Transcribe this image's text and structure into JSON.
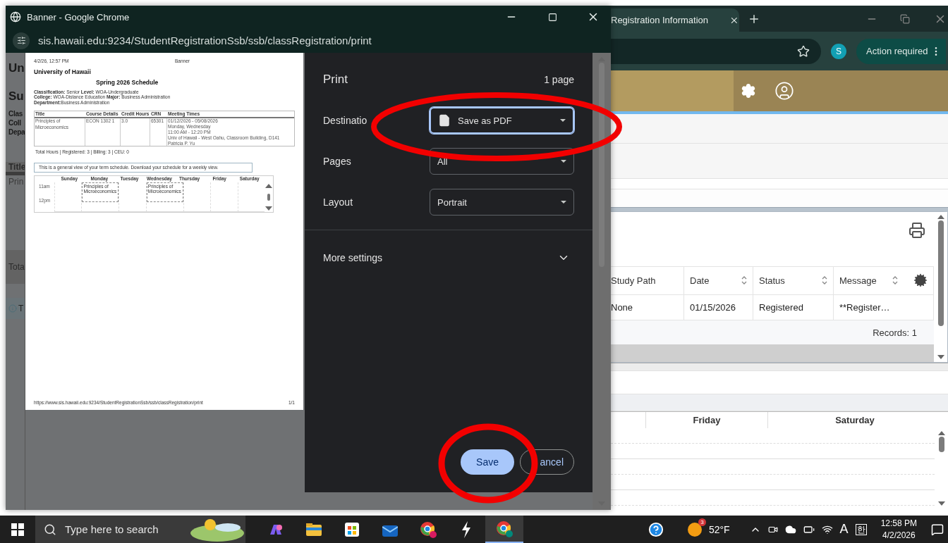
{
  "background_browser": {
    "tab": {
      "title": "Registration Information"
    },
    "profile_initial": "S",
    "action_button": "Action required",
    "table": {
      "columns": [
        {
          "label": "Study Path",
          "sortable": false
        },
        {
          "label": "Date",
          "sortable": true
        },
        {
          "label": "Status",
          "sortable": true
        },
        {
          "label": "Message",
          "sortable": true
        }
      ],
      "rows": [
        [
          "None",
          "01/15/2026",
          "Registered",
          "**Register…"
        ]
      ],
      "records": "Records: 1"
    },
    "schedule_days": [
      "Friday",
      "Saturday"
    ]
  },
  "popup": {
    "title": "Banner - Google Chrome",
    "url": "sis.hawaii.edu:9234/StudentRegistrationSsb/ssb/classRegistration/print",
    "page_fragments": [
      {
        "text": "Un",
        "kind": "title"
      },
      {
        "text": "Su",
        "kind": "title"
      },
      {
        "text": "Clas",
        "kind": "label"
      },
      {
        "text": "Coll",
        "kind": "label"
      },
      {
        "text": "Depa",
        "kind": "label"
      },
      {
        "text": "Title",
        "kind": "column"
      },
      {
        "text": "Prin",
        "kind": "cell"
      },
      {
        "text": "Tota",
        "kind": "total"
      },
      {
        "text": "T",
        "kind": "notice"
      }
    ]
  },
  "preview": {
    "printed_at": "4/2/26, 12:57 PM",
    "header_title": "Banner",
    "university": "University of Hawaii",
    "schedule_title": "Spring 2026 Schedule",
    "info_lines": [
      "**Classification:** Senior **Level:** WOA-Undergraduate",
      "**College:** WOA-Distance Education **Major:** Business Administration",
      "**Department:**Business Administration"
    ],
    "columns": [
      "Title",
      "Course Details",
      "Credit Hours",
      "CRN",
      "Meeting Times"
    ],
    "rows": [
      {
        "cells": [
          "Principles of Microeconomics",
          "ECON 1302 1",
          "3.0",
          "65301"
        ],
        "meeting": [
          "01/12/2026 - 05/08/2026",
          "Monday, Wednesday",
          "11:00 AM - 12:20 PM",
          "Univ of Hawaii - West Oahu, Classroom Building, D141",
          "Patricia P. Yu"
        ]
      }
    ],
    "totals": "Total Hours | Registered: 3 | Billing: 3 | CEU: 0",
    "notice": "This is a general view of your term schedule. Download your schedule for a weekly view.",
    "week": [
      {
        "day": "Sunday"
      },
      {
        "day": "Monday",
        "events": [
          "Principles of Microeconomics"
        ]
      },
      {
        "day": "Tuesday"
      },
      {
        "day": "Wednesday",
        "events": [
          "Principles of Microeconomics"
        ]
      },
      {
        "day": "Thursday"
      },
      {
        "day": "Friday"
      },
      {
        "day": "Saturday"
      }
    ],
    "times": [
      "11am",
      "12pm"
    ],
    "footer_url": "https://www.sis.hawaii.edu:9234/StudentRegistrationSsb/ssb/classRegistration/print",
    "page_number": "1/1"
  },
  "print_dialog": {
    "title": "Print",
    "page_count": "1 page",
    "settings": [
      {
        "label": "Destinatio",
        "value": "Save as PDF",
        "focused": true,
        "kind": "destination"
      },
      {
        "label": "Pages",
        "value": "All",
        "focused": false,
        "kind": "plain"
      },
      {
        "label": "Layout",
        "value": "Portrait",
        "focused": false,
        "kind": "plain"
      }
    ],
    "more_settings": {
      "label": "More settings",
      "expanded": false
    },
    "buttons": [
      {
        "label": "Save",
        "kind": "primary"
      },
      {
        "label": "ancel",
        "kind": "secondary"
      }
    ]
  },
  "taskbar": {
    "search_placeholder": "Type here to search",
    "weather_badge": "3",
    "temperature": "52°F",
    "input_mode": "A",
    "ime": "한",
    "time": "12:58 PM",
    "date": "4/2/2026"
  }
}
